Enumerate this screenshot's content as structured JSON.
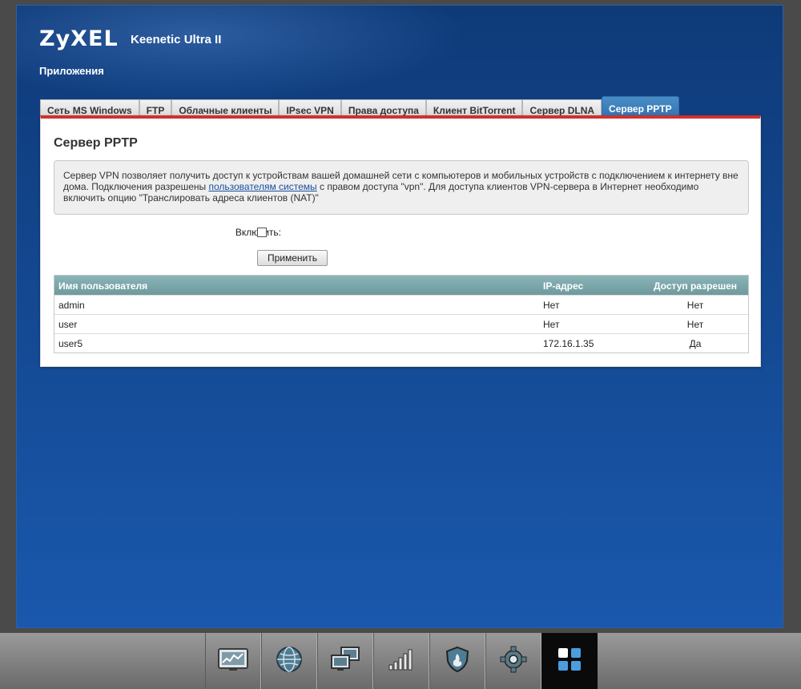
{
  "header": {
    "brand": "ZyXEL",
    "model": "Keenetic Ultra II",
    "section": "Приложения"
  },
  "tabs": [
    {
      "label": "Сеть MS Windows"
    },
    {
      "label": "FTP"
    },
    {
      "label": "Облачные клиенты"
    },
    {
      "label": "IPsec VPN"
    },
    {
      "label": "Права доступа"
    },
    {
      "label": "Клиент BitTorrent"
    },
    {
      "label": "Сервер DLNA"
    },
    {
      "label": "Сервер PPTP",
      "active": true
    }
  ],
  "page": {
    "title": "Сервер PPTP",
    "info_part1": "Сервер VPN позволяет получить доступ к устройствам вашей домашней сети с компьютеров и мобильных устройств с подключением к интернету вне дома. Подключения разрешены ",
    "info_link": "пользователям системы",
    "info_part2": " с правом доступа \"vpn\". Для доступа клиентов VPN-сервера в Интернет необходимо включить опцию \"Транслировать адреса клиентов (NAT)\"",
    "enable_label": "Включить:",
    "enable_checked": false,
    "apply_label": "Применить"
  },
  "table": {
    "headers": [
      "Имя пользователя",
      "IP-адрес",
      "Доступ разрешен"
    ],
    "rows": [
      [
        "admin",
        "Нет",
        "Нет"
      ],
      [
        "user",
        "Нет",
        "Нет"
      ],
      [
        "user5",
        "172.16.1.35",
        "Да"
      ]
    ]
  },
  "taskbar": [
    {
      "icon": "monitor-chart-icon"
    },
    {
      "icon": "globe-icon"
    },
    {
      "icon": "network-computers-icon"
    },
    {
      "icon": "wifi-signal-icon"
    },
    {
      "icon": "security-shield-icon"
    },
    {
      "icon": "settings-gear-icon"
    },
    {
      "icon": "applications-grid-icon",
      "active": true
    }
  ],
  "colors": {
    "background_blue": "#1a58ad",
    "tab_active": "#2e6fae",
    "accent_red": "#d03030",
    "table_header": "#7aa6a9"
  }
}
